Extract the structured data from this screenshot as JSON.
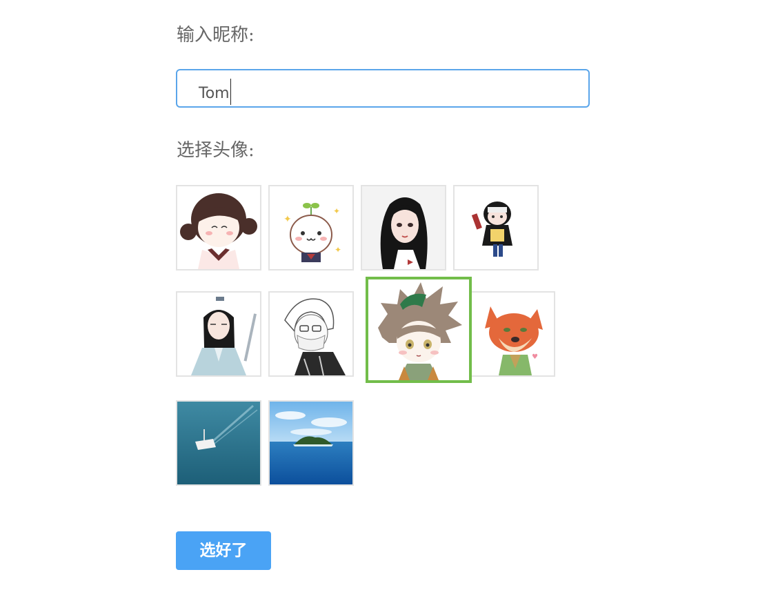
{
  "form": {
    "nickname_label": "输入昵称:",
    "nickname_value": "Tom",
    "avatar_label": "选择头像:",
    "submit_label": "选好了"
  },
  "avatars": [
    {
      "name": "avatar-girl-buns",
      "selected": false
    },
    {
      "name": "avatar-sprout-bun",
      "selected": false
    },
    {
      "name": "avatar-long-hair-girl",
      "selected": false
    },
    {
      "name": "avatar-hooded-chibi",
      "selected": false
    },
    {
      "name": "avatar-swordsman",
      "selected": false
    },
    {
      "name": "avatar-masked-boy",
      "selected": false
    },
    {
      "name": "avatar-spiky-hair-chibi",
      "selected": true
    },
    {
      "name": "avatar-fox",
      "selected": false
    },
    {
      "name": "avatar-sea-boat",
      "selected": false
    },
    {
      "name": "avatar-sea-island",
      "selected": false
    }
  ],
  "colors": {
    "input_border": "#5aa5ea",
    "selected_border": "#72bd4a",
    "button_bg": "#4aa3f5"
  }
}
